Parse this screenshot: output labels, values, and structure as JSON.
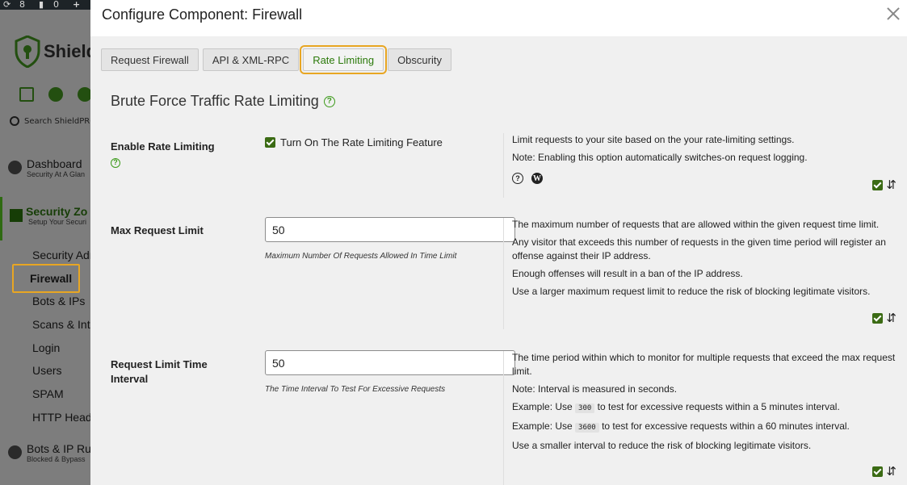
{
  "admin_bar": {
    "updates": "8",
    "comments": "0",
    "new": "+"
  },
  "sidebar": {
    "logo_text": "Shield",
    "search_text": "Search ShieldPRO",
    "dashboard": {
      "title": "Dashboard",
      "subtitle": "Security At A Glan"
    },
    "security_zones": {
      "title": "Security Zo",
      "subtitle": "Setup Your Securi"
    },
    "sub_items": [
      "Security Adm",
      "Firewall",
      "Bots & IPs",
      "Scans & Inte",
      "Login",
      "Users",
      "SPAM",
      "HTTP Heade"
    ],
    "bots_rules": {
      "title": "Bots & IP Ru",
      "subtitle": "Blocked & Bypass"
    }
  },
  "modal": {
    "title": "Configure Component: Firewall",
    "tabs": [
      {
        "label": "Request Firewall",
        "active": false
      },
      {
        "label": "API & XML-RPC",
        "active": false
      },
      {
        "label": "Rate Limiting",
        "active": true
      },
      {
        "label": "Obscurity",
        "active": false
      }
    ],
    "section_title": "Brute Force Traffic Rate Limiting",
    "help_glyph": "?",
    "sort_glyph": "⇵",
    "options": {
      "enable": {
        "label": "Enable Rate Limiting",
        "checkbox_label": "Turn On The Rate Limiting Feature",
        "checked": true,
        "desc": [
          "Limit requests to your site based on the your rate-limiting settings.",
          "Note: Enabling this option automatically switches-on request logging."
        ]
      },
      "max_request": {
        "label": "Max Request Limit",
        "value": "50",
        "hint": "Maximum Number Of Requests Allowed In Time Limit",
        "desc": [
          "The maximum number of requests that are allowed within the given request time limit.",
          "Any visitor that exceeds this number of requests in the given time period will register an offense against their IP address.",
          "Enough offenses will result in a ban of the IP address.",
          "Use a larger maximum request limit to reduce the risk of blocking legitimate visitors."
        ]
      },
      "interval": {
        "label": "Request Limit Time Interval",
        "value": "50",
        "hint": "The Time Interval To Test For Excessive Requests",
        "desc": {
          "line1": "The time period within which to monitor for multiple requests that exceed the max request limit.",
          "line2": "Note: Interval is measured in seconds.",
          "ex1_pre": "Example: Use",
          "ex1_code": "300",
          "ex1_post": "to test for excessive requests within a 5 minutes interval.",
          "ex2_pre": "Example: Use",
          "ex2_code": "3600",
          "ex2_post": "to test for excessive requests within a 60 minutes interval.",
          "line5": "Use a smaller interval to reduce the risk of blocking legitimate visitors."
        }
      }
    }
  },
  "colors": {
    "accent_green": "#2c7a0b",
    "highlight_orange": "#e8a623",
    "checkbox_green": "#3b6b14"
  }
}
